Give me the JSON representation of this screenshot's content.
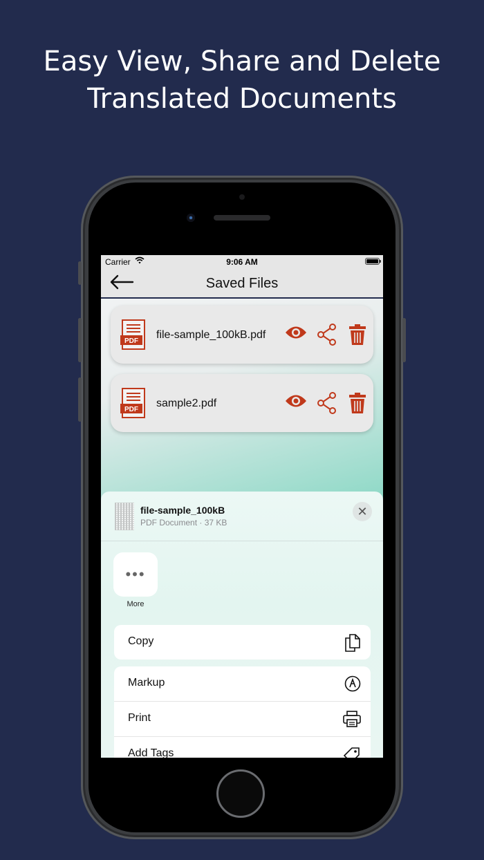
{
  "headline": {
    "line1": "Easy View, Share and Delete",
    "line2": "Translated Documents"
  },
  "status_bar": {
    "carrier": "Carrier",
    "time": "9:06 AM"
  },
  "nav": {
    "title": "Saved Files",
    "back_icon": "arrow-left-icon"
  },
  "files": [
    {
      "name": "file-sample_100kB.pdf",
      "badge": "PDF"
    },
    {
      "name": "sample2.pdf",
      "badge": "PDF"
    }
  ],
  "accent_color": "#c0391b",
  "share_sheet": {
    "title": "file-sample_100kB",
    "subtitle": "PDF Document · 37 KB",
    "close": "✕",
    "more_label": "More",
    "actions_group1": [
      {
        "label": "Copy",
        "icon": "copy-icon"
      }
    ],
    "actions_group2": [
      {
        "label": "Markup",
        "icon": "markup-icon"
      },
      {
        "label": "Print",
        "icon": "printer-icon"
      },
      {
        "label": "Add Tags",
        "icon": "tag-icon"
      }
    ]
  }
}
